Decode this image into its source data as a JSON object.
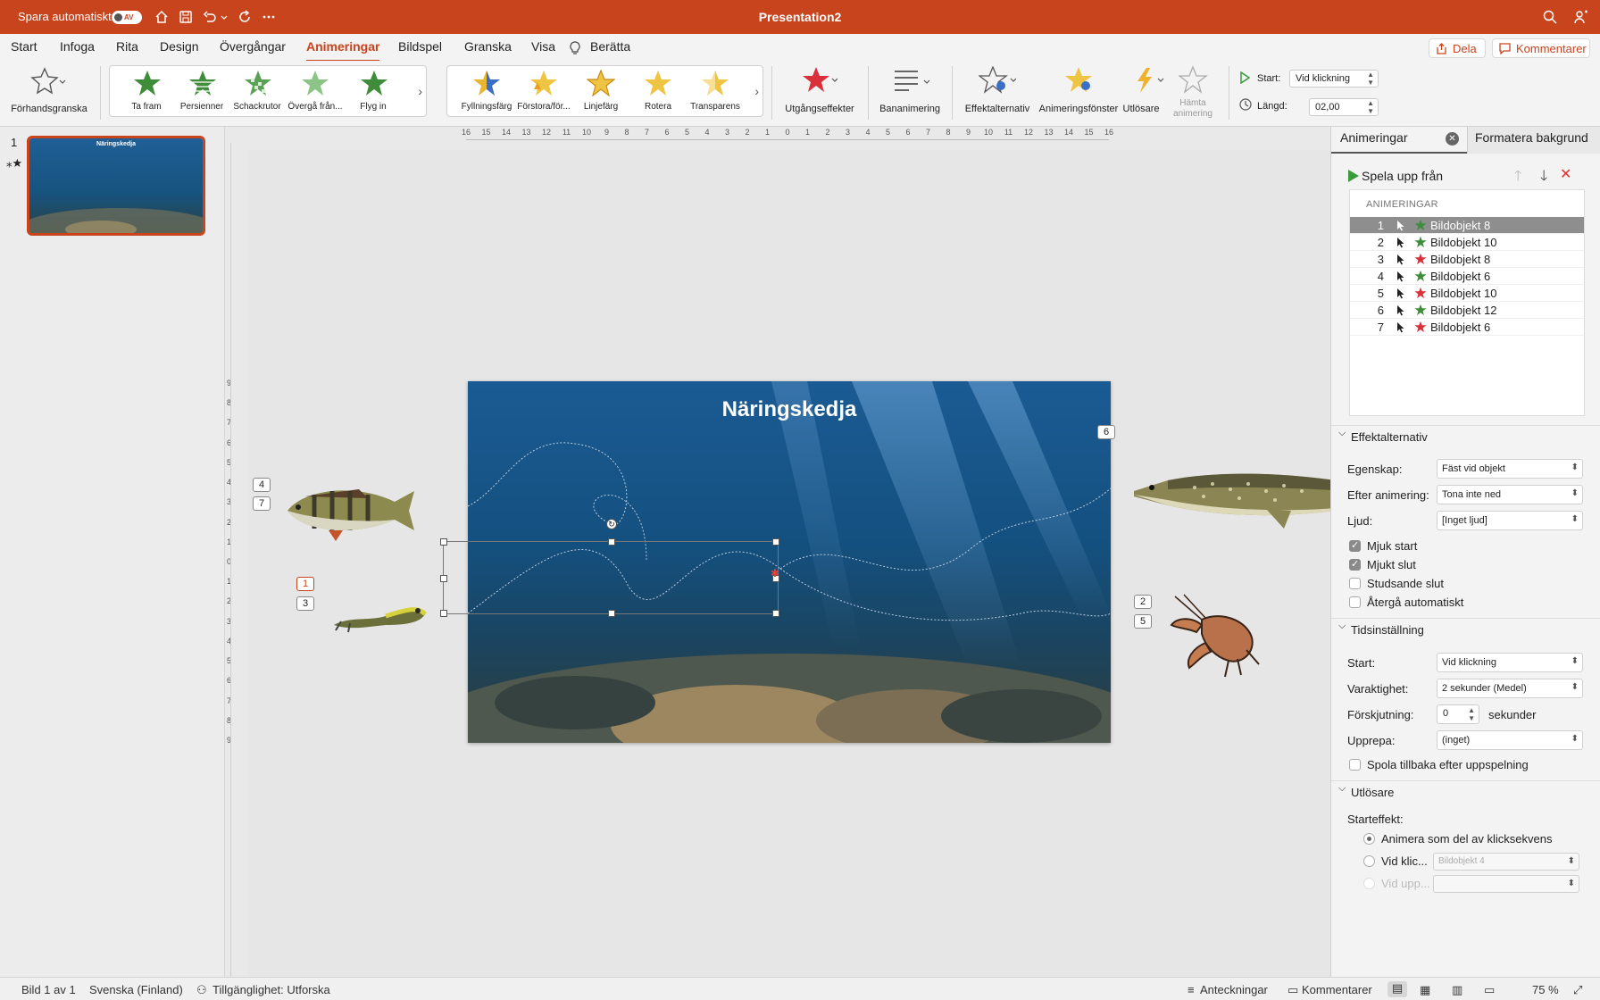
{
  "titlebar": {
    "autosave_label": "Spara automatiskt",
    "autosave_state": "AV",
    "document_title": "Presentation2",
    "accent_color": "#c8441d"
  },
  "menu": {
    "tabs": [
      "Start",
      "Infoga",
      "Rita",
      "Design",
      "Övergångar",
      "Animeringar",
      "Bildspel",
      "Granska",
      "Visa",
      "Berätta"
    ],
    "active_tab": "Animeringar",
    "share_label": "Dela",
    "comments_label": "Kommentarer"
  },
  "ribbon": {
    "preview_label": "Förhandsgranska",
    "entrance_effects": [
      "Ta fram",
      "Persienner",
      "Schackrutor",
      "Övergå från...",
      "Flyg in"
    ],
    "emphasis_effects": [
      "Fyllningsfärg",
      "Förstora/för...",
      "Linjefärg",
      "Rotera",
      "Transparens"
    ],
    "exit_effects_label": "Utgångseffekter",
    "motion_path_label": "Bananimering",
    "effect_options_label": "Effektalternativ",
    "animation_pane_label": "Animeringsfönster",
    "trigger_label": "Utlösare",
    "fetch_animation_label": "Hämta animering",
    "start_label": "Start:",
    "start_value": "Vid klickning",
    "duration_label": "Längd:",
    "duration_value": "02,00"
  },
  "rulers": {
    "horizontal_ticks": [
      "16",
      "15",
      "14",
      "13",
      "12",
      "11",
      "10",
      "9",
      "8",
      "7",
      "6",
      "5",
      "4",
      "3",
      "2",
      "1",
      "0",
      "1",
      "2",
      "3",
      "4",
      "5",
      "6",
      "7",
      "8",
      "9",
      "10",
      "11",
      "12",
      "13",
      "14",
      "15",
      "16"
    ],
    "vertical_ticks": [
      "9",
      "8",
      "7",
      "6",
      "5",
      "4",
      "3",
      "2",
      "1",
      "0",
      "1",
      "2",
      "3",
      "4",
      "5",
      "6",
      "7",
      "8",
      "9"
    ]
  },
  "thumbnails": {
    "slide_number": "1",
    "slide_title": "Näringskedja"
  },
  "slide": {
    "title": "Näringskedja",
    "tags": {
      "perch_a": "4",
      "perch_b": "7",
      "larva_a": "1",
      "larva_b": "3",
      "pike": "6",
      "crayfish_a": "2",
      "crayfish_b": "5"
    }
  },
  "panel": {
    "tab_animations": "Animeringar",
    "tab_background": "Formatera bakgrund",
    "play_from_label": "Spela upp från",
    "list_header": "ANIMERINGAR",
    "animations": [
      {
        "num": "1",
        "name": "Bildobjekt 8",
        "type": "entrance"
      },
      {
        "num": "2",
        "name": "Bildobjekt 10",
        "type": "entrance"
      },
      {
        "num": "3",
        "name": "Bildobjekt 8",
        "type": "exit"
      },
      {
        "num": "4",
        "name": "Bildobjekt 6",
        "type": "entrance"
      },
      {
        "num": "5",
        "name": "Bildobjekt 10",
        "type": "exit"
      },
      {
        "num": "6",
        "name": "Bildobjekt 12",
        "type": "entrance"
      },
      {
        "num": "7",
        "name": "Bildobjekt 6",
        "type": "exit"
      }
    ],
    "effect_options": {
      "header": "Effektalternativ",
      "property_label": "Egenskap:",
      "property_value": "Fäst vid objekt",
      "after_anim_label": "Efter animering:",
      "after_anim_value": "Tona inte ned",
      "sound_label": "Ljud:",
      "sound_value": "[Inget ljud]",
      "smooth_start_label": "Mjuk start",
      "smooth_end_label": "Mjukt slut",
      "bounce_end_label": "Studsande slut",
      "auto_reverse_label": "Återgå automatiskt"
    },
    "timing": {
      "header": "Tidsinställning",
      "start_label": "Start:",
      "start_value": "Vid klickning",
      "duration_label": "Varaktighet:",
      "duration_value": "2 sekunder (Medel)",
      "delay_label": "Förskjutning:",
      "delay_value": "0",
      "delay_unit": "sekunder",
      "repeat_label": "Upprepa:",
      "repeat_value": "(inget)",
      "rewind_label": "Spola tillbaka efter uppspelning"
    },
    "triggers": {
      "header": "Utlösare",
      "start_effect_label": "Starteffekt:",
      "option_sequence": "Animera som del av klicksekvens",
      "option_click": "Vid klic...",
      "option_click_value": "Bildobjekt 4",
      "option_play": "Vid upp..."
    }
  },
  "statusbar": {
    "slide_info": "Bild 1 av 1",
    "language": "Svenska (Finland)",
    "accessibility": "Tillgänglighet: Utforska",
    "notes_label": "Anteckningar",
    "comments_label": "Kommentarer",
    "zoom": "75 %"
  }
}
